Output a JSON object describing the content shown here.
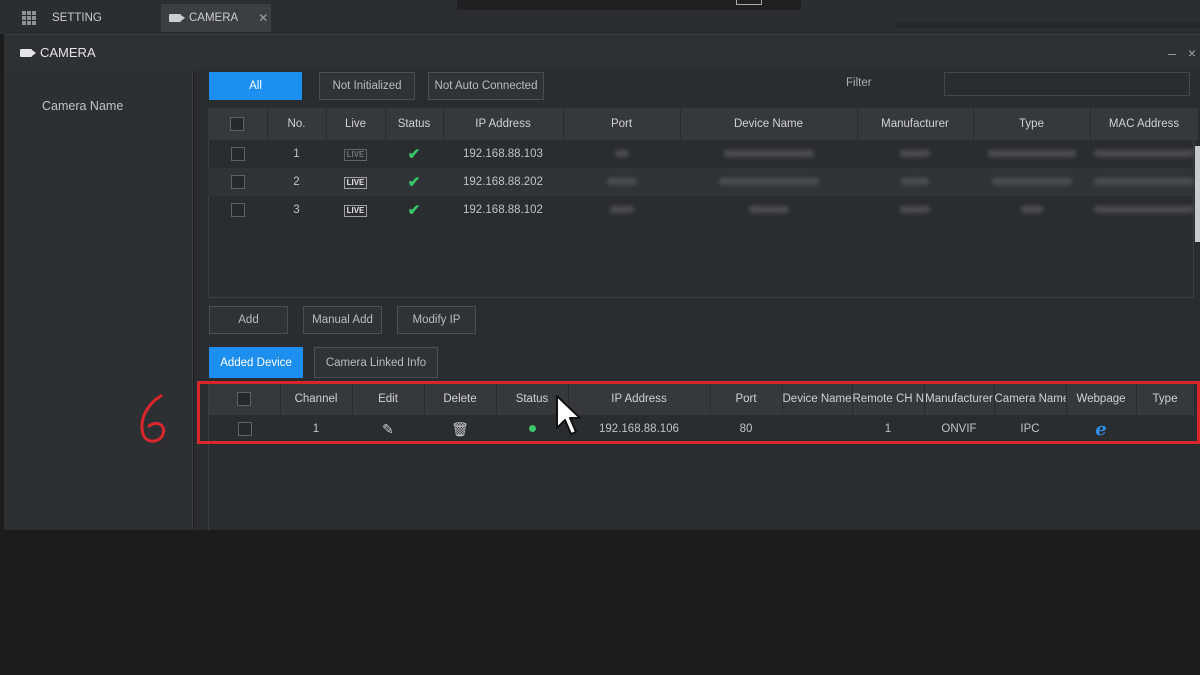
{
  "top_tabs": {
    "setting": "SETTING",
    "camera": "CAMERA",
    "close": "✕"
  },
  "window": {
    "title": "CAMERA",
    "controls": "– ×"
  },
  "sidebar": {
    "camera_name": "Camera Name"
  },
  "filter_tabs": [
    "All",
    "Not Initialized",
    "Not Auto Connected"
  ],
  "filter": {
    "label": "Filter",
    "value": ""
  },
  "search_table": {
    "headers": [
      "No.",
      "Live",
      "Status",
      "IP Address",
      "Port",
      "Device Name",
      "Manufacturer",
      "Type",
      "MAC Address"
    ],
    "rows": [
      {
        "no": "1",
        "live": "LIVE",
        "ip": "192.168.88.103"
      },
      {
        "no": "2",
        "live": "LIVE",
        "ip": "192.168.88.202"
      },
      {
        "no": "3",
        "live": "LIVE",
        "ip": "192.168.88.102"
      }
    ]
  },
  "actions": {
    "add": "Add",
    "manual_add": "Manual Add",
    "modify_ip": "Modify IP"
  },
  "lower_tabs": {
    "added_device": "Added Device",
    "camera_linked_info": "Camera Linked Info"
  },
  "added_table": {
    "headers": [
      "Channel",
      "Edit",
      "Delete",
      "Status",
      "IP Address",
      "Port",
      "Device Name",
      "Remote CH No.",
      "Manufacturer",
      "Camera Name",
      "Webpage",
      "Type"
    ],
    "rows": [
      {
        "channel": "1",
        "ip": "192.168.88.106",
        "port": "80",
        "device_name": "",
        "remote_ch": "1",
        "manufacturer": "ONVIF",
        "camera_name": "IPC",
        "type": ""
      }
    ]
  },
  "annotation": {
    "step": "6"
  },
  "colors": {
    "accent": "#1d8ff0",
    "highlight_box": "#d8262c",
    "status_ok": "#3cc46a"
  }
}
